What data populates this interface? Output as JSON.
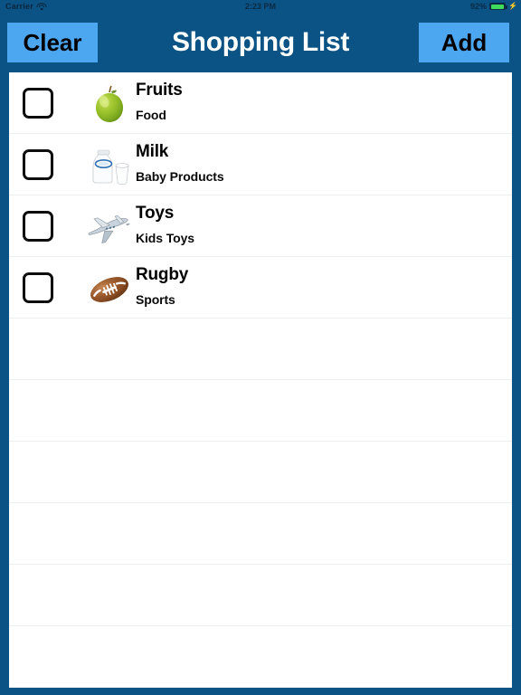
{
  "status_bar": {
    "carrier": "Carrier",
    "wifi_icon": "wifi-icon",
    "time": "2:23 PM",
    "battery_percent": "92%",
    "battery_level": 92,
    "battery_icon": "battery-icon",
    "charging_icon": "lightning-bolt-icon"
  },
  "nav": {
    "clear_label": "Clear",
    "title": "Shopping List",
    "add_label": "Add"
  },
  "colors": {
    "nav_background": "#0b5285",
    "button_background": "#4da6f0",
    "button_text": "#000000",
    "title_text": "#ffffff",
    "table_background": "#ffffff",
    "separator": "#eceef0",
    "battery_fill": "#3ddc5b"
  },
  "list": {
    "items": [
      {
        "title": "Fruits",
        "subtitle": "Food",
        "checked": false,
        "image": "green-apple-image"
      },
      {
        "title": "Milk",
        "subtitle": "Baby Products",
        "checked": false,
        "image": "milk-bottle-image"
      },
      {
        "title": "Toys",
        "subtitle": "Kids Toys",
        "checked": false,
        "image": "airplane-image"
      },
      {
        "title": "Rugby",
        "subtitle": "Sports",
        "checked": false,
        "image": "football-image"
      }
    ],
    "empty_row_count": 6
  }
}
